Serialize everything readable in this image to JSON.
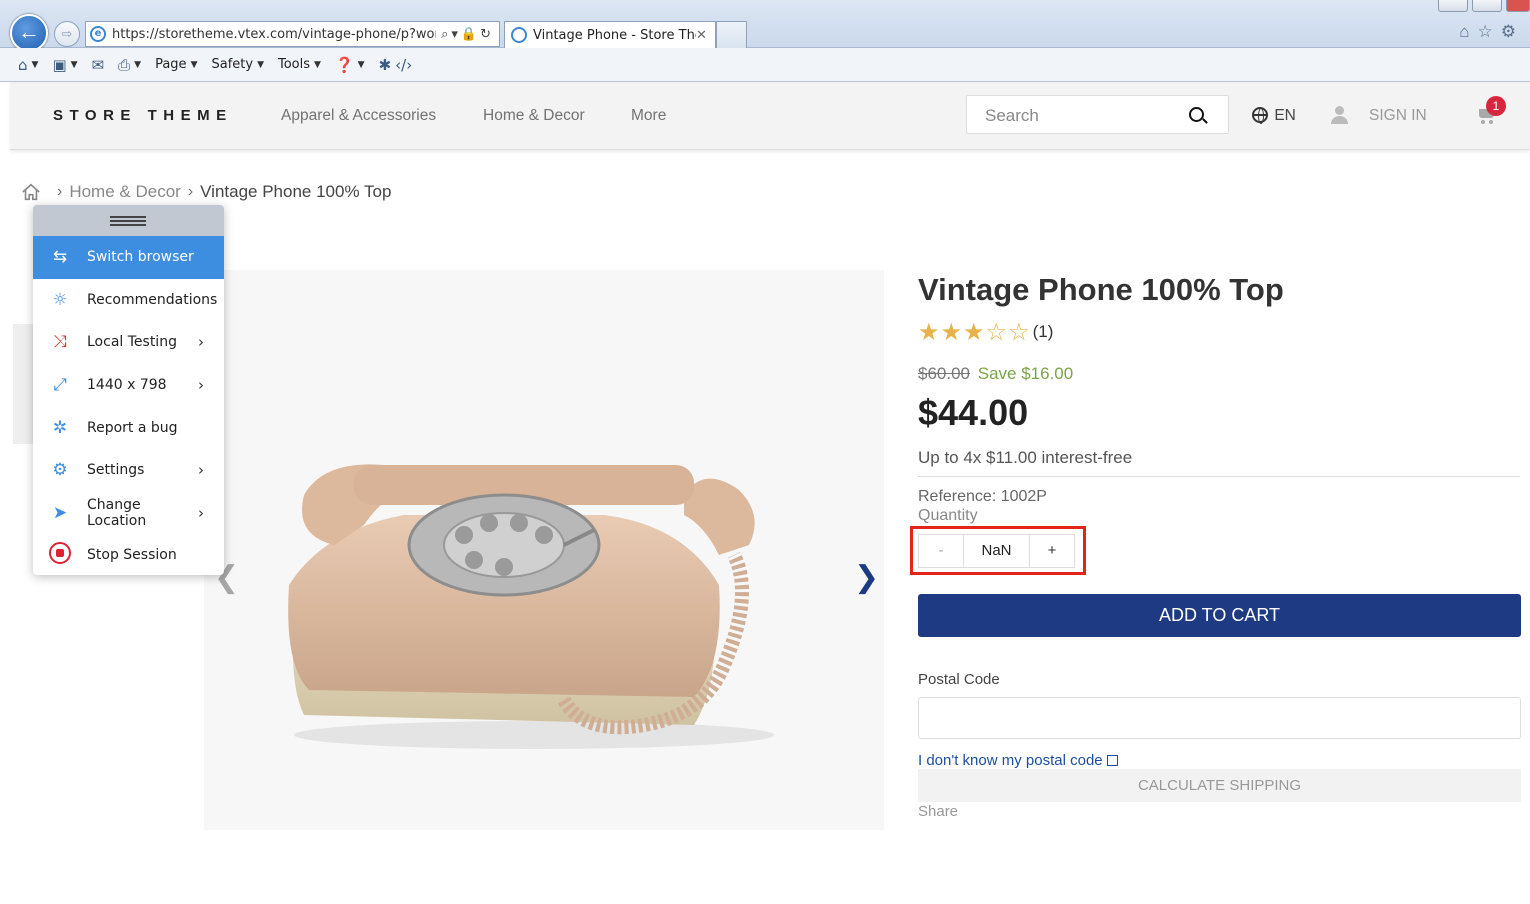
{
  "browser": {
    "url": "https://storetheme.vtex.com/vintage-phone/p?workspz",
    "tab_title": "Vintage Phone - Store The...",
    "tab_close": "✕",
    "commands": [
      "Page",
      "Safety",
      "Tools"
    ]
  },
  "site": {
    "logo": "STORE THEME",
    "nav": [
      "Apparel & Accessories",
      "Home & Decor",
      "More"
    ],
    "search_placeholder": "Search",
    "language": "EN",
    "sign_in": "SIGN IN",
    "cart_count": "1"
  },
  "breadcrumb": {
    "items": [
      "Home & Decor"
    ],
    "current": "Vintage Phone 100% Top"
  },
  "product": {
    "title": "Vintage Phone 100% Top",
    "rating": 3,
    "rating_max": 5,
    "review_count": "(1)",
    "list_price": "$60.00",
    "savings": "Save $16.00",
    "price": "$44.00",
    "installments": "Up to 4x $11.00 interest-free",
    "reference": "Reference: 1002P",
    "quantity_label": "Quantity",
    "quantity_minus": "-",
    "quantity_value": "NaN",
    "quantity_plus": "+",
    "add_to_cart": "ADD TO CART",
    "postal_label": "Postal Code",
    "postal_link": "I don't know my postal code",
    "calculate_shipping": "CALCULATE SHIPPING",
    "share": "Share"
  },
  "session_menu": {
    "items": [
      {
        "label": "Switch browser",
        "icon": "switch-icon"
      },
      {
        "label": "Recommendations",
        "icon": "bulb-icon"
      },
      {
        "label": "Local Testing",
        "icon": "local-testing-icon"
      },
      {
        "label": "1440 x 798",
        "icon": "resize-icon"
      },
      {
        "label": "Report a bug",
        "icon": "bug-icon"
      },
      {
        "label": "Settings",
        "icon": "gear-icon"
      },
      {
        "label": "Change Location",
        "icon": "location-arrow-icon"
      },
      {
        "label": "Stop Session",
        "icon": "stop-icon"
      }
    ]
  },
  "colors": {
    "accent_blue": "#1e3a82",
    "menu_active": "#3d8de0",
    "highlight_red": "#e4231b",
    "save_green": "#79a447",
    "badge_red": "#d6273e"
  }
}
